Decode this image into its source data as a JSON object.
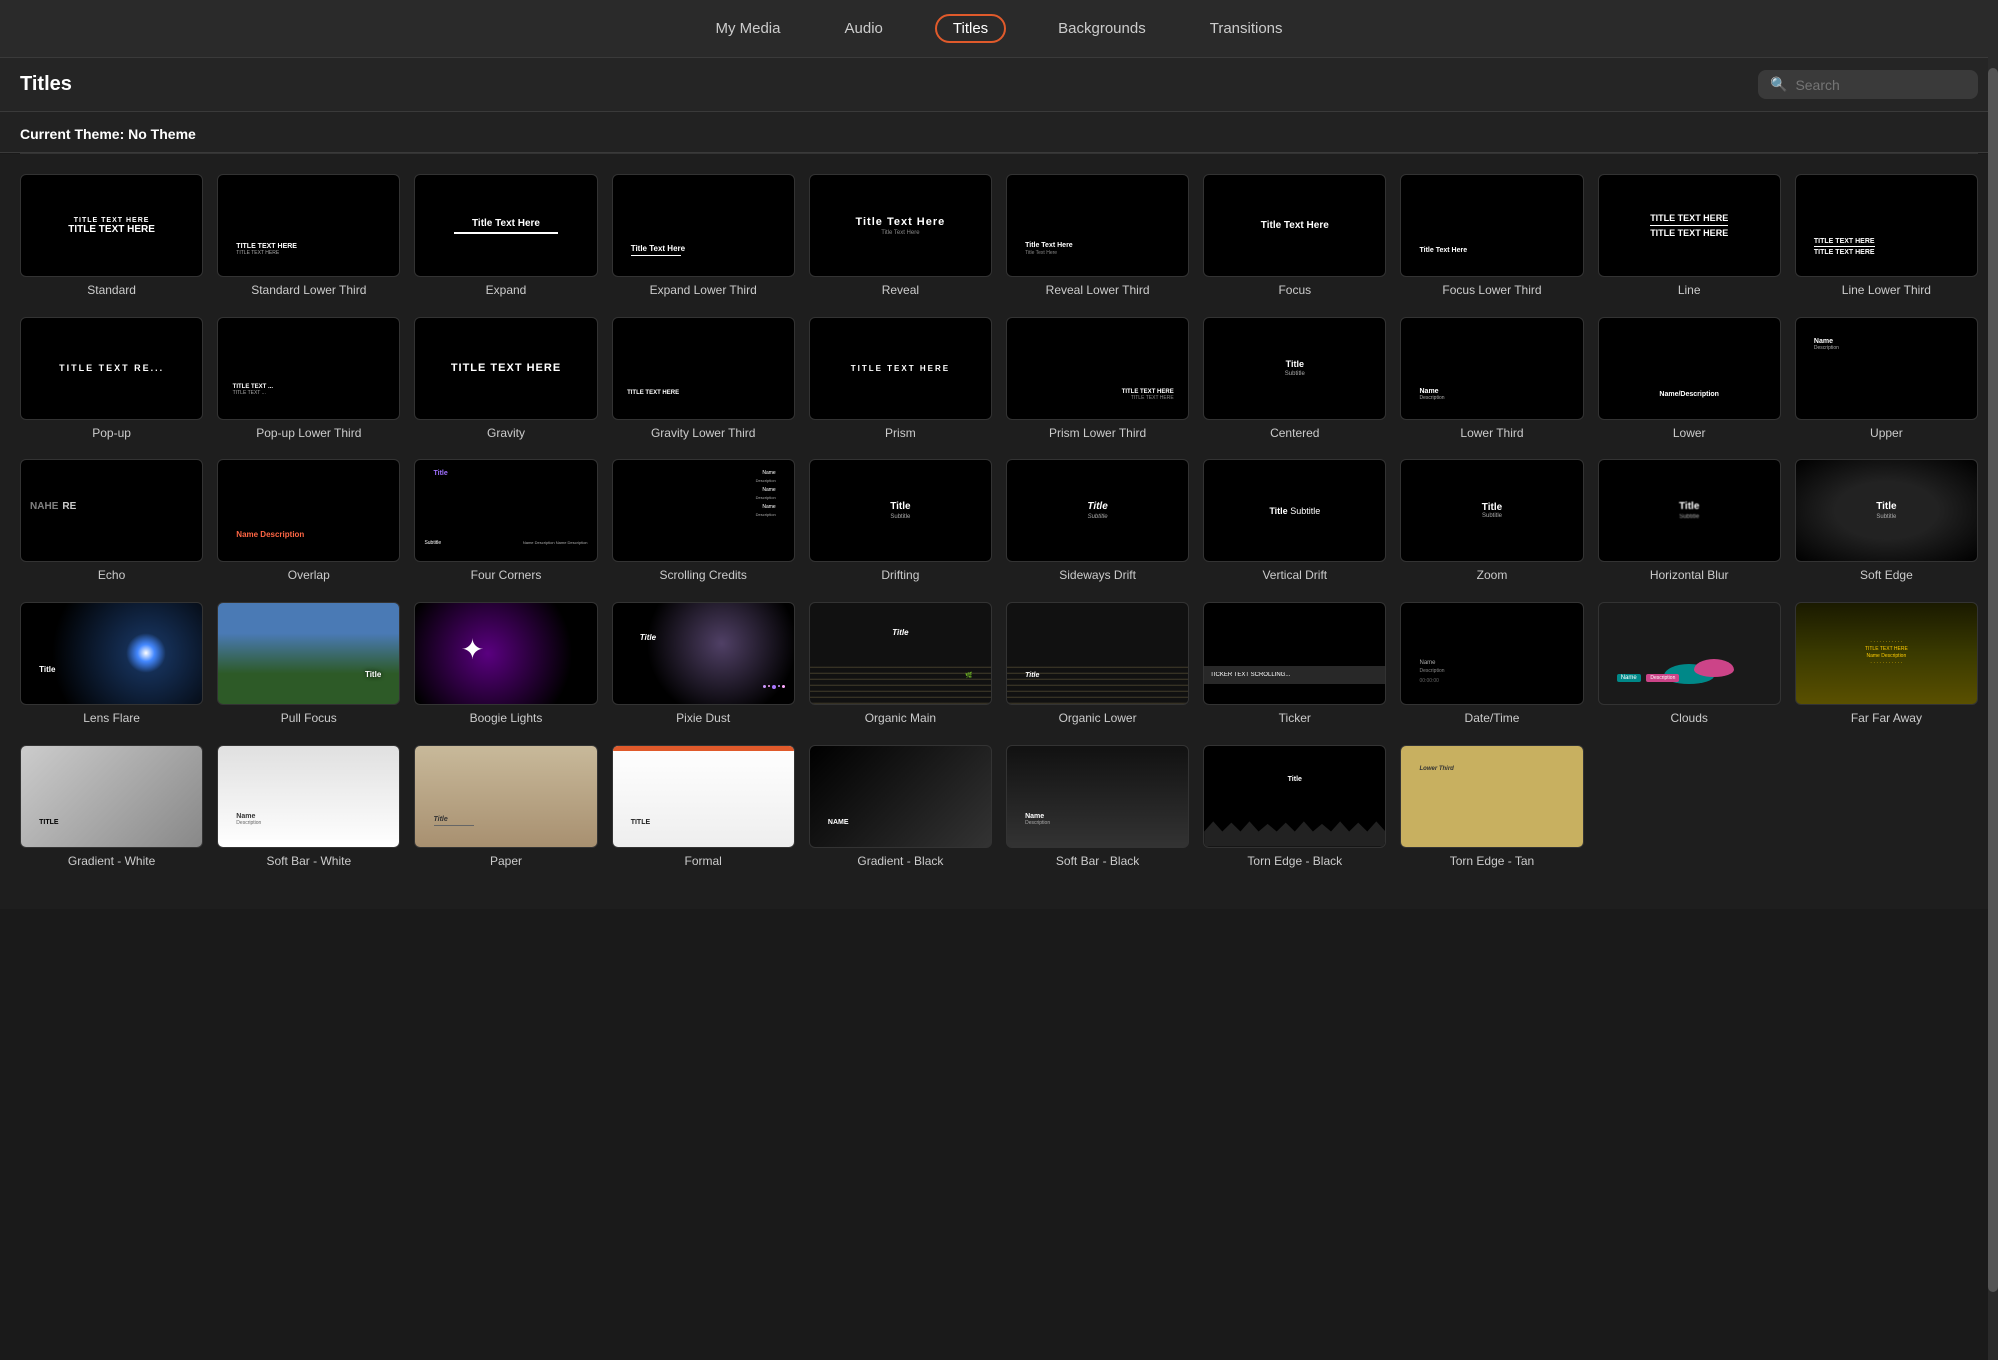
{
  "nav": {
    "items": [
      {
        "label": "My Media",
        "key": "my-media",
        "active": false
      },
      {
        "label": "Audio",
        "key": "audio",
        "active": false
      },
      {
        "label": "Titles",
        "key": "titles",
        "active": true
      },
      {
        "label": "Backgrounds",
        "key": "backgrounds",
        "active": false
      },
      {
        "label": "Transitions",
        "key": "transitions",
        "active": false
      }
    ]
  },
  "header": {
    "title": "Titles",
    "search_placeholder": "Search"
  },
  "theme_bar": {
    "label": "Current Theme: No Theme"
  },
  "titles": [
    {
      "label": "Standard"
    },
    {
      "label": "Standard Lower Third"
    },
    {
      "label": "Expand"
    },
    {
      "label": "Expand Lower Third"
    },
    {
      "label": "Reveal"
    },
    {
      "label": "Reveal Lower Third"
    },
    {
      "label": "Focus"
    },
    {
      "label": "Focus Lower Third"
    },
    {
      "label": "Line"
    },
    {
      "label": "Line Lower Third"
    },
    {
      "label": "Pop-up"
    },
    {
      "label": "Pop-up Lower Third"
    },
    {
      "label": "Gravity"
    },
    {
      "label": "Gravity Lower Third"
    },
    {
      "label": "Prism"
    },
    {
      "label": "Prism Lower Third"
    },
    {
      "label": "Centered"
    },
    {
      "label": "Lower Third"
    },
    {
      "label": "Lower"
    },
    {
      "label": "Upper"
    },
    {
      "label": "Echo"
    },
    {
      "label": "Overlap"
    },
    {
      "label": "Four Corners"
    },
    {
      "label": "Scrolling Credits"
    },
    {
      "label": "Drifting"
    },
    {
      "label": "Sideways Drift"
    },
    {
      "label": "Vertical Drift"
    },
    {
      "label": "Zoom"
    },
    {
      "label": "Horizontal Blur"
    },
    {
      "label": "Soft Edge"
    },
    {
      "label": "Lens Flare"
    },
    {
      "label": "Pull Focus"
    },
    {
      "label": "Boogie Lights"
    },
    {
      "label": "Pixie Dust"
    },
    {
      "label": "Organic Main"
    },
    {
      "label": "Organic Lower"
    },
    {
      "label": "Ticker"
    },
    {
      "label": "Date/Time"
    },
    {
      "label": "Clouds"
    },
    {
      "label": "Far Far Away"
    },
    {
      "label": "Gradient - White"
    },
    {
      "label": "Soft Bar - White"
    },
    {
      "label": "Paper"
    },
    {
      "label": "Formal"
    },
    {
      "label": "Gradient - Black"
    },
    {
      "label": "Soft Bar - Black"
    },
    {
      "label": "Torn Edge - Black"
    },
    {
      "label": "Torn Edge - Tan"
    }
  ]
}
